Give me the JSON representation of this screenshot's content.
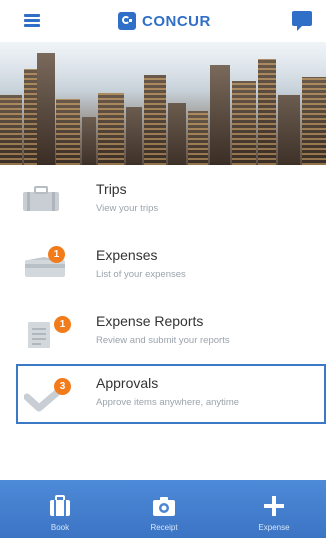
{
  "header": {
    "brand": "CONCUR"
  },
  "menu": {
    "items": [
      {
        "title": "Trips",
        "subtitle": "View your trips"
      },
      {
        "title": "Expenses",
        "subtitle": "List of your expenses",
        "badge": "1"
      },
      {
        "title": "Expense Reports",
        "subtitle": "Review and submit your reports",
        "badge": "1"
      },
      {
        "title": "Approvals",
        "subtitle": "Approve items anywhere, anytime",
        "badge": "3"
      }
    ]
  },
  "bottom_bar": {
    "tabs": [
      {
        "label": "Book",
        "icon": "suitcase-icon"
      },
      {
        "label": "Receipt",
        "icon": "camera-icon"
      },
      {
        "label": "Expense",
        "icon": "plus-icon"
      }
    ]
  },
  "colors": {
    "brand_blue": "#2f6fc8",
    "badge_orange": "#f27b1b",
    "bottom_bar": "#4383d1"
  }
}
